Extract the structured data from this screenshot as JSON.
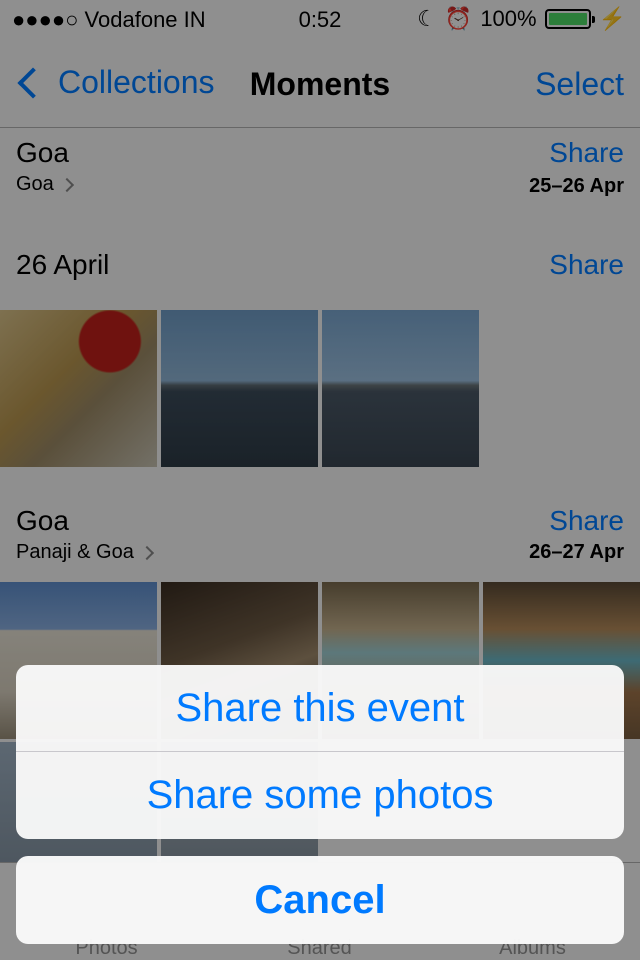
{
  "status_bar": {
    "carrier": "●●●●○ Vodafone IN",
    "time": "0:52",
    "battery": "100%"
  },
  "nav": {
    "back_label": "Collections",
    "title": "Moments",
    "select_label": "Select"
  },
  "sections": [
    {
      "title": "Goa",
      "subtitle": "Goa",
      "share_label": "Share",
      "date": "25–26 Apr"
    },
    {
      "title": "26 April",
      "share_label": "Share"
    },
    {
      "title": "Goa",
      "subtitle": "Panaji & Goa",
      "share_label": "Share",
      "date": "26–27 Apr"
    }
  ],
  "tabs": [
    "Photos",
    "Shared",
    "Albums"
  ],
  "action_sheet": {
    "option_1": "Share this event",
    "option_2": "Share some photos",
    "cancel": "Cancel"
  },
  "colors": {
    "accent": "#007aff",
    "battery": "#4cd964"
  }
}
